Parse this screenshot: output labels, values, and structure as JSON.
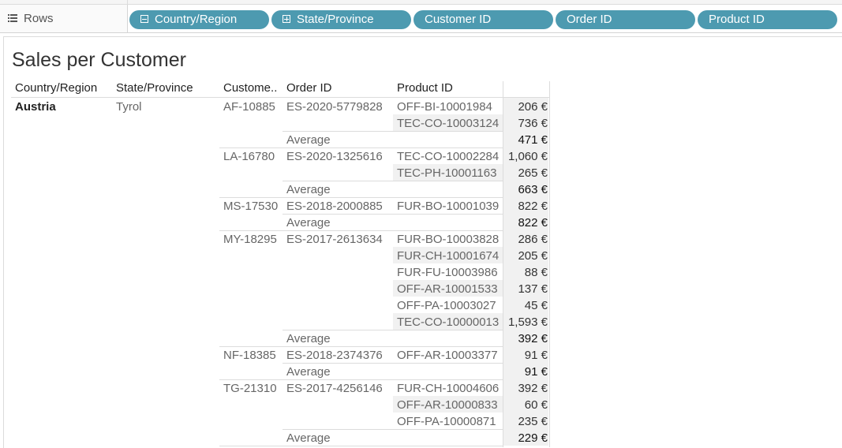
{
  "shelf": {
    "label": "Rows",
    "pills": [
      {
        "label": "Country/Region",
        "toggle": "minus"
      },
      {
        "label": "State/Province",
        "toggle": "plus"
      },
      {
        "label": "Customer ID"
      },
      {
        "label": "Order ID"
      },
      {
        "label": "Product ID"
      }
    ]
  },
  "sheet": {
    "title": "Sales per Customer",
    "headers": [
      "Country/Region",
      "State/Province",
      "Custome..",
      "Order ID",
      "Product ID"
    ],
    "country": "Austria",
    "state": "Tyrol",
    "average_label": "Average",
    "customers": [
      {
        "id": "AF-10885",
        "average": "471 €",
        "orders": [
          {
            "id": "ES-2020-5779828",
            "products": [
              {
                "id": "OFF-BI-10001984",
                "value": "206 €"
              },
              {
                "id": "TEC-CO-10003124",
                "value": "736 €"
              }
            ]
          }
        ]
      },
      {
        "id": "LA-16780",
        "average": "663 €",
        "orders": [
          {
            "id": "ES-2020-1325616",
            "products": [
              {
                "id": "TEC-CO-10002284",
                "value": "1,060 €"
              },
              {
                "id": "TEC-PH-10001163",
                "value": "265 €"
              }
            ]
          }
        ]
      },
      {
        "id": "MS-17530",
        "average": "822 €",
        "orders": [
          {
            "id": "ES-2018-2000885",
            "products": [
              {
                "id": "FUR-BO-10001039",
                "value": "822 €"
              }
            ]
          }
        ]
      },
      {
        "id": "MY-18295",
        "average": "392 €",
        "orders": [
          {
            "id": "ES-2017-2613634",
            "products": [
              {
                "id": "FUR-BO-10003828",
                "value": "286 €"
              },
              {
                "id": "FUR-CH-10001674",
                "value": "205 €"
              },
              {
                "id": "FUR-FU-10003986",
                "value": "88 €"
              },
              {
                "id": "OFF-AR-10001533",
                "value": "137 €"
              },
              {
                "id": "OFF-PA-10003027",
                "value": "45 €"
              },
              {
                "id": "TEC-CO-10000013",
                "value": "1,593 €"
              }
            ]
          }
        ]
      },
      {
        "id": "NF-18385",
        "average": "91 €",
        "orders": [
          {
            "id": "ES-2018-2374376",
            "products": [
              {
                "id": "OFF-AR-10003377",
                "value": "91 €"
              }
            ]
          }
        ]
      },
      {
        "id": "TG-21310",
        "average": "229 €",
        "orders": [
          {
            "id": "ES-2017-4256146",
            "products": [
              {
                "id": "FUR-CH-10004606",
                "value": "392 €"
              },
              {
                "id": "OFF-AR-10000833",
                "value": "60 €"
              },
              {
                "id": "OFF-PA-10000871",
                "value": "235 €"
              }
            ]
          }
        ]
      }
    ]
  }
}
